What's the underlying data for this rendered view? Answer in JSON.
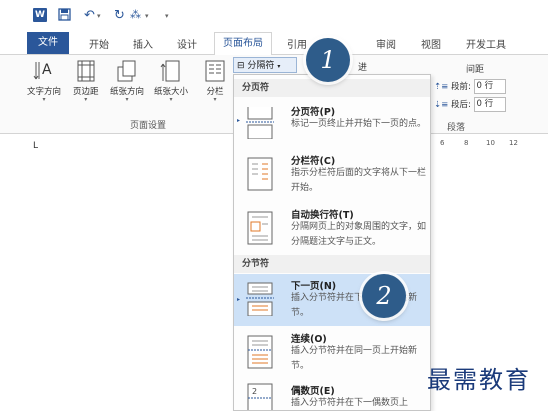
{
  "quick_access": {
    "word_logo": "W",
    "undo_symbol": "↶",
    "redo_symbol": "↻",
    "format_symbol": "⁂",
    "more_symbol": "▾"
  },
  "tabs": [
    "文件",
    "开始",
    "插入",
    "设计",
    "页面布局",
    "引用",
    "审阅",
    "视图",
    "开发工具"
  ],
  "ribbon": {
    "buttons": [
      {
        "label": "文字方向"
      },
      {
        "label": "页边距"
      },
      {
        "label": "纸张方向"
      },
      {
        "label": "纸张大小"
      },
      {
        "label": "分栏"
      }
    ],
    "group_label": "页面设置",
    "breaks_button": "分隔符",
    "line_numbers_partial": "进",
    "spacing_group": "间距",
    "before_label": "段前:",
    "before_value": "0 行",
    "after_label": "段后:",
    "after_value": "0 行",
    "paragraph_label": "段落",
    "ruler_numbers": [
      "6",
      "8",
      "10",
      "12"
    ],
    "ruler_corner": "L"
  },
  "menu": {
    "page_breaks_header": "分页符",
    "section_breaks_header": "分节符",
    "items": [
      {
        "title": "分页符(P)",
        "desc": "标记一页终止并开始下一页的点。"
      },
      {
        "title": "分栏符(C)",
        "desc": "指示分栏符后面的文字将从下一栏开始。"
      },
      {
        "title": "自动换行符(T)",
        "desc": "分隔网页上的对象周围的文字，如分隔题注文字与正文。"
      },
      {
        "title": "下一页(N)",
        "desc": "插入分节符并在下一页上开始新节。"
      },
      {
        "title": "连续(O)",
        "desc": "插入分节符并在同一页上开始新节。"
      },
      {
        "title": "偶数页(E)",
        "desc": "插入分节符并在下一偶数页上"
      }
    ]
  },
  "callouts": [
    "1",
    "2"
  ],
  "watermark": "最需教育",
  "colors": {
    "accent": "#2b579a",
    "selected_item": "#cde1f7",
    "bubble": "#2e5c8a"
  }
}
